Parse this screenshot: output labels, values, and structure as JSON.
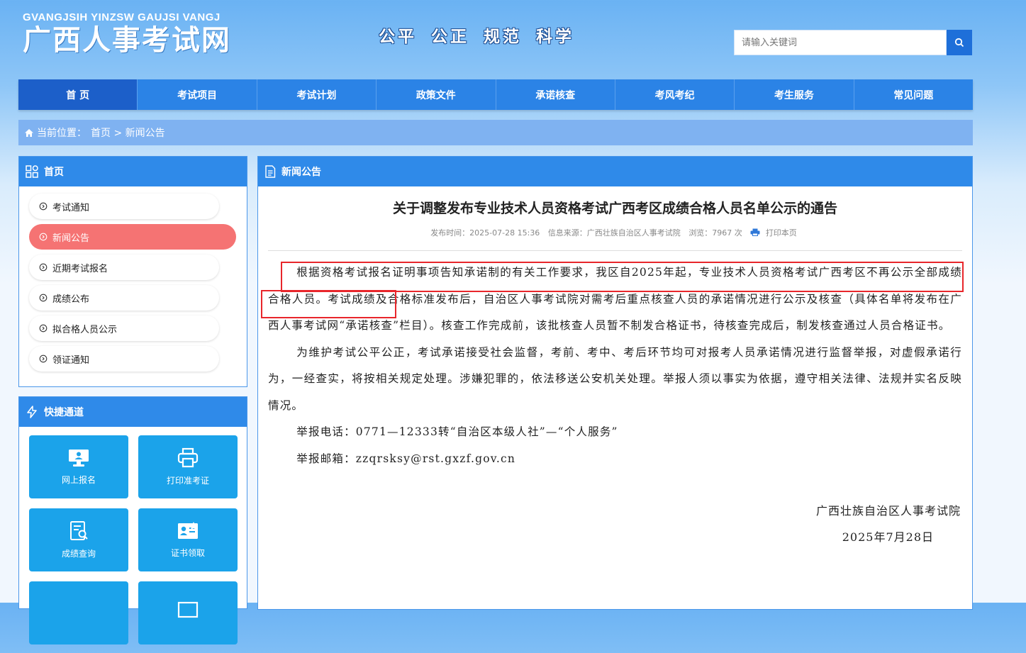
{
  "header": {
    "logo_sub": "GVANGJSIH YINZSW GAUJSI VANGJ",
    "logo_main": "广西人事考试网",
    "slogan": "公平 公正 规范 科学",
    "search_placeholder": "请输入关键词"
  },
  "nav": [
    "首 页",
    "考试项目",
    "考试计划",
    "政策文件",
    "承诺核查",
    "考风考纪",
    "考生服务",
    "常见问题"
  ],
  "breadcrumb": {
    "prefix": "当前位置：",
    "path": "首页 > 新闻公告"
  },
  "sidebar": {
    "title": "首页",
    "items": [
      "考试通知",
      "新闻公告",
      "近期考试报名",
      "成绩公布",
      "拟合格人员公示",
      "领证通知"
    ],
    "active_index": 1,
    "quick_title": "快捷通道",
    "quick": [
      "网上报名",
      "打印准考证",
      "成绩查询",
      "证书领取"
    ]
  },
  "article": {
    "section": "新闻公告",
    "title": "关于调整发布专业技术人员资格考试广西考区成绩合格人员名单公示的通告",
    "meta": {
      "time": "发布时间：2025-07-28 15:36",
      "source": "信息来源：广西壮族自治区人事考试院",
      "views": "浏览：7967 次",
      "print": "打印本页"
    },
    "paragraphs": [
      "根据资格考试报名证明事项告知承诺制的有关工作要求，我区自2025年起，专业技术人员资格考试广西考区不再公示全部成绩合格人员。考试成绩及合格标准发布后，自治区人事考试院对需考后重点核查人员的承诺情况进行公示及核查（具体名单将发布在广西人事考试网“承诺核查”栏目）。核查工作完成前，该批核查人员暂不制发合格证书，待核查完成后，制发核查通过人员合格证书。",
      "为维护考试公平公正，考试承诺接受社会监督，考前、考中、考后环节均可对报考人员承诺情况进行监督举报，对虚假承诺行为，一经查实，将按相关规定处理。涉嫌犯罪的，依法移送公安机关处理。举报人须以事实为依据，遵守相关法律、法规并实名反映情况。",
      "举报电话：0771—12333转“自治区本级人社”—“个人服务”",
      "举报邮箱：zzqrsksy@rst.gxzf.gov.cn"
    ],
    "signature": "广西壮族自治区人事考试院",
    "date": "2025年7月28日"
  },
  "colors": {
    "nav": "#2b83e6",
    "active_menu": "#f57373",
    "quick_tile": "#1ba3ea",
    "highlight": "#e8262b"
  }
}
